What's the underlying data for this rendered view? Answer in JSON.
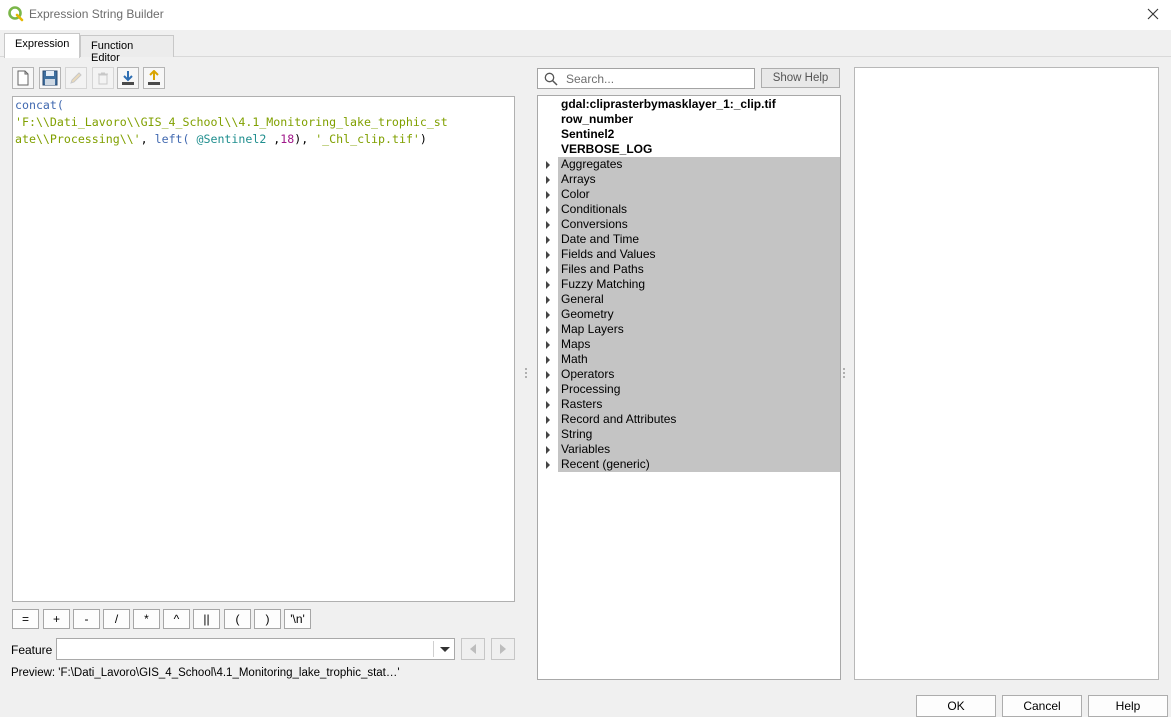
{
  "window": {
    "title": "Expression String Builder"
  },
  "tabs": [
    {
      "label": "Expression"
    },
    {
      "label": "Function Editor"
    }
  ],
  "editor": {
    "line1": {
      "fn": "concat("
    },
    "line2": {
      "str": "'F:\\\\Dati_Lavoro\\\\GIS_4_School\\\\4.1_Monitoring_lake_trophic_st"
    },
    "line3": {
      "str_a": "ate\\\\Processing\\\\'",
      "sep_a": ", ",
      "fn_left": "left(",
      "sp": " ",
      "var": "@Sentinel2",
      "sep_b": " ,",
      "num": "18",
      "sep_c": "), ",
      "str_b": "'_Chl_clip.tif'",
      "close": ")"
    }
  },
  "operators": [
    "=",
    "+",
    "-",
    "/",
    "*",
    "^",
    "||",
    "(",
    ")",
    "'\\n'"
  ],
  "feature": {
    "label": "Feature",
    "value": ""
  },
  "preview": {
    "text": "Preview:  'F:\\Dati_Lavoro\\GIS_4_School\\4.1_Monitoring_lake_trophic_stat…'"
  },
  "search": {
    "placeholder": "Search..."
  },
  "show_help": {
    "label": "Show Help"
  },
  "tree": {
    "fields": [
      "gdal:cliprasterbymasklayer_1:_clip.tif",
      "row_number",
      "Sentinel2",
      "VERBOSE_LOG"
    ],
    "groups": [
      "Aggregates",
      "Arrays",
      "Color",
      "Conditionals",
      "Conversions",
      "Date and Time",
      "Fields and Values",
      "Files and Paths",
      "Fuzzy Matching",
      "General",
      "Geometry",
      "Map Layers",
      "Maps",
      "Math",
      "Operators",
      "Processing",
      "Rasters",
      "Record and Attributes",
      "String",
      "Variables",
      "Recent (generic)"
    ]
  },
  "buttons": {
    "ok": "OK",
    "cancel": "Cancel",
    "help": "Help"
  },
  "colors": {
    "function": "#4169b0",
    "string": "#80a000",
    "number": "#a0188a",
    "variable": "#1f8e8e",
    "group_bg": "#c4c4c4"
  }
}
